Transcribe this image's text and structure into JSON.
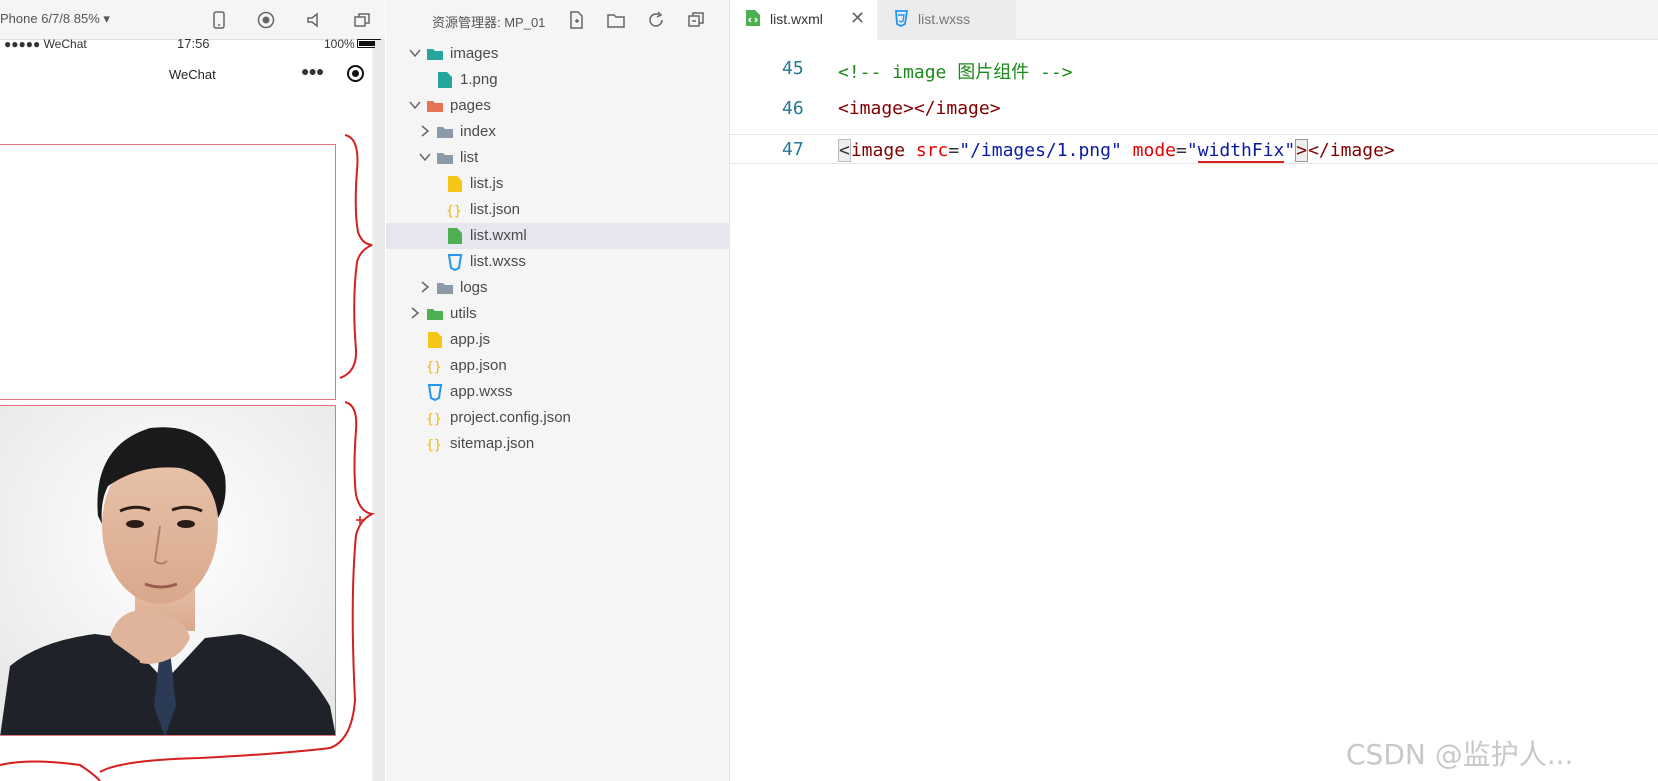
{
  "simulator": {
    "device_label": "Phone 6/7/8 85% ▾",
    "status": {
      "signal": "●●●●● WeChat",
      "time": "17:56",
      "battery": "100%"
    },
    "nav_title": "WeChat",
    "capsule_dots": "●●●"
  },
  "explorer": {
    "title": "资源管理器: MP_01",
    "tree": [
      {
        "label": "images",
        "icon": "folder-images-icon",
        "expanded": true
      },
      {
        "label": "1.png",
        "icon": "image-file-icon"
      },
      {
        "label": "pages",
        "icon": "folder-pages-icon",
        "expanded": true
      },
      {
        "label": "index",
        "icon": "folder-icon",
        "expanded": false
      },
      {
        "label": "list",
        "icon": "folder-open-icon",
        "expanded": true
      },
      {
        "label": "list.js",
        "icon": "js-file-icon"
      },
      {
        "label": "list.json",
        "icon": "json-file-icon"
      },
      {
        "label": "list.wxml",
        "icon": "wxml-file-icon",
        "selected": true
      },
      {
        "label": "list.wxss",
        "icon": "wxss-file-icon"
      },
      {
        "label": "logs",
        "icon": "folder-icon",
        "expanded": false
      },
      {
        "label": "utils",
        "icon": "folder-utils-icon",
        "expanded": false
      },
      {
        "label": "app.js",
        "icon": "js-file-icon"
      },
      {
        "label": "app.json",
        "icon": "json-file-icon"
      },
      {
        "label": "app.wxss",
        "icon": "wxss-file-icon"
      },
      {
        "label": "project.config.json",
        "icon": "json-file-icon"
      },
      {
        "label": "sitemap.json",
        "icon": "json-file-icon"
      }
    ]
  },
  "editor": {
    "tabs": [
      {
        "label": "list.wxml",
        "active": true
      },
      {
        "label": "list.wxss",
        "active": false
      }
    ],
    "close_glyph": "✕",
    "lines": [
      {
        "number": "45",
        "comment": "<!-- image 图片组件 -->"
      },
      {
        "number": "46",
        "tag_open": "<image>",
        "tag_close": "</image>"
      },
      {
        "number": "47",
        "lt": "<",
        "tag_name": "image",
        "attr1": "src",
        "eq1": "=",
        "val1": "\"/images/1.png\"",
        "attr2": "mode",
        "eq2": "=",
        "val2_prefix": "\"",
        "val2": "widthFix",
        "val2_suffix": "\"",
        "gt": ">",
        "tag_close": "</image>"
      }
    ]
  },
  "watermark": "CSDN @监护人..."
}
